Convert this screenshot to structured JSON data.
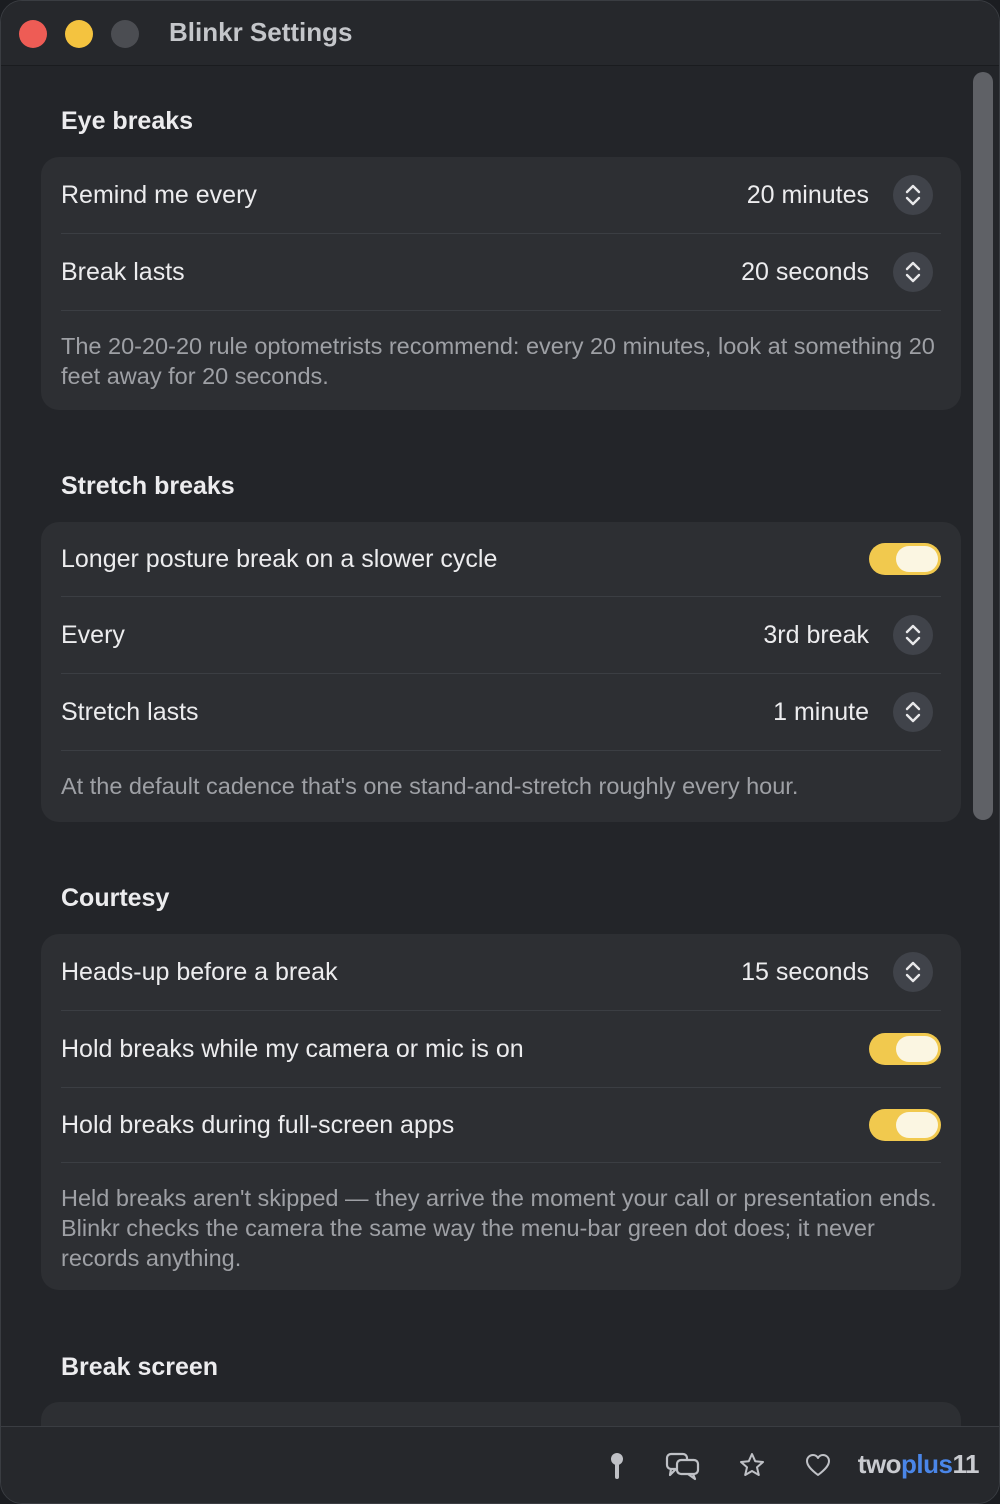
{
  "window": {
    "title": "Blinkr Settings"
  },
  "colors": {
    "accent": "#f1c94e",
    "background": "#232529",
    "card": "#2d2f33",
    "brand_blue": "#4a86e8"
  },
  "sections": {
    "eye_breaks": {
      "title": "Eye breaks",
      "remind_label": "Remind me every",
      "remind_value": "20 minutes",
      "lasts_label": "Break lasts",
      "lasts_value": "20 seconds",
      "note": "The 20-20-20 rule optometrists recommend: every 20 minutes, look at something 20 feet away for 20 seconds."
    },
    "stretch_breaks": {
      "title": "Stretch breaks",
      "posture_label": "Longer posture break on a slower cycle",
      "posture_on": true,
      "every_label": "Every",
      "every_value": "3rd break",
      "lasts_label": "Stretch lasts",
      "lasts_value": "1 minute",
      "note": "At the default cadence that's one stand-and-stretch roughly every hour."
    },
    "courtesy": {
      "title": "Courtesy",
      "headsup_label": "Heads-up before a break",
      "headsup_value": "15 seconds",
      "camera_label": "Hold breaks while my camera or mic is on",
      "camera_on": true,
      "fullscreen_label": "Hold breaks during full-screen apps",
      "fullscreen_on": true,
      "note": "Held breaks aren't skipped — they arrive the moment your call or presentation ends. Blinkr checks the camera the same way the menu-bar green dot does; it never records anything."
    },
    "break_screen": {
      "title": "Break screen"
    }
  },
  "footer": {
    "icons": [
      "pin-icon",
      "chat-bubbles-icon",
      "star-icon",
      "heart-icon"
    ],
    "brand_two": "two",
    "brand_plus": "plus",
    "brand_eleven": "11"
  }
}
